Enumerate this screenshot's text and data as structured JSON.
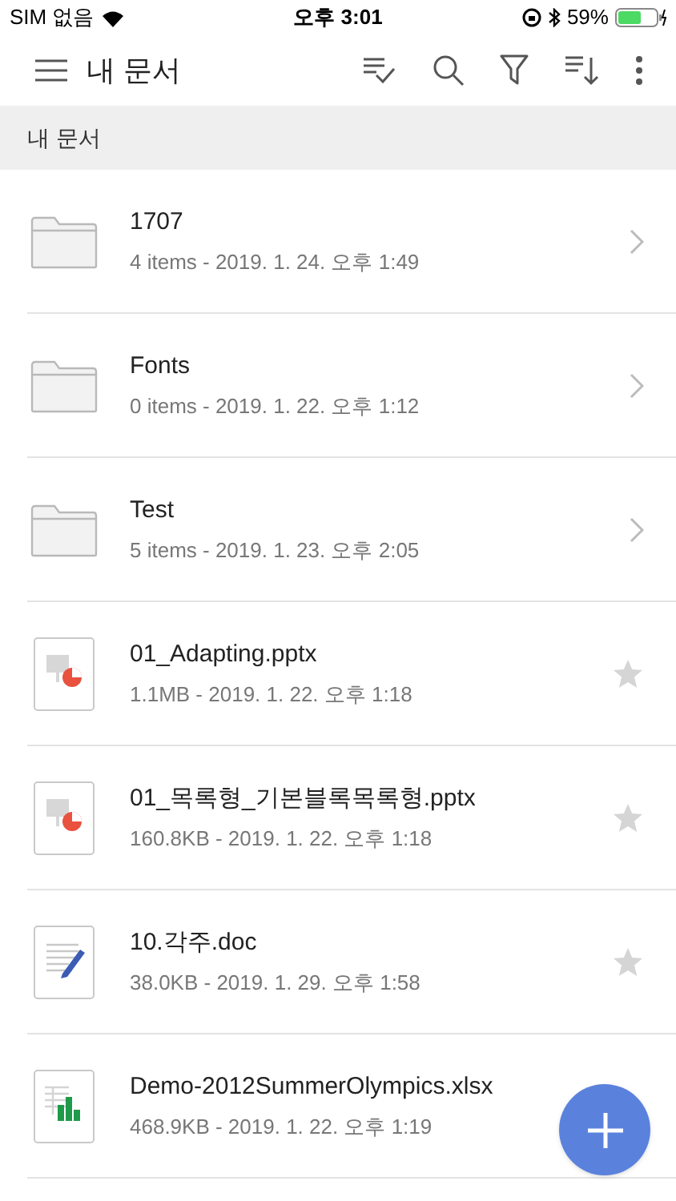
{
  "status_bar": {
    "carrier": "SIM 없음",
    "time": "오후 3:01",
    "battery": "59%"
  },
  "header": {
    "title": "내 문서"
  },
  "breadcrumb": "내 문서",
  "items": [
    {
      "kind": "folder",
      "name": "1707",
      "meta": "4 items - 2019. 1. 24. 오후 1:49"
    },
    {
      "kind": "folder",
      "name": "Fonts",
      "meta": "0 items - 2019. 1. 22. 오후 1:12"
    },
    {
      "kind": "folder",
      "name": "Test",
      "meta": "5 items - 2019. 1. 23. 오후 2:05"
    },
    {
      "kind": "pptx",
      "name": "01_Adapting.pptx",
      "meta": "1.1MB - 2019. 1. 22. 오후 1:18",
      "starred": false
    },
    {
      "kind": "pptx",
      "name": "01_목록형_기본블록목록형.pptx",
      "meta": "160.8KB - 2019. 1. 22. 오후 1:18",
      "starred": false
    },
    {
      "kind": "doc",
      "name": "10.각주.doc",
      "meta": "38.0KB - 2019. 1. 29. 오후 1:58",
      "starred": false
    },
    {
      "kind": "xlsx",
      "name": "Demo-2012SummerOlympics.xlsx",
      "meta": "468.9KB - 2019. 1. 22. 오후 1:19"
    }
  ]
}
